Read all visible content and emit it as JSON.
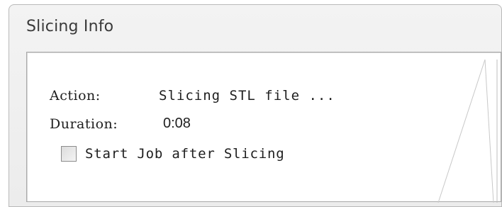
{
  "panel": {
    "title": "Slicing Info"
  },
  "fields": {
    "action_label": "Action:",
    "action_value": "Slicing STL file ...",
    "duration_label": "Duration:",
    "duration_value": "0:08"
  },
  "options": {
    "start_job_label": "Start Job after Slicing",
    "start_job_checked": false
  }
}
